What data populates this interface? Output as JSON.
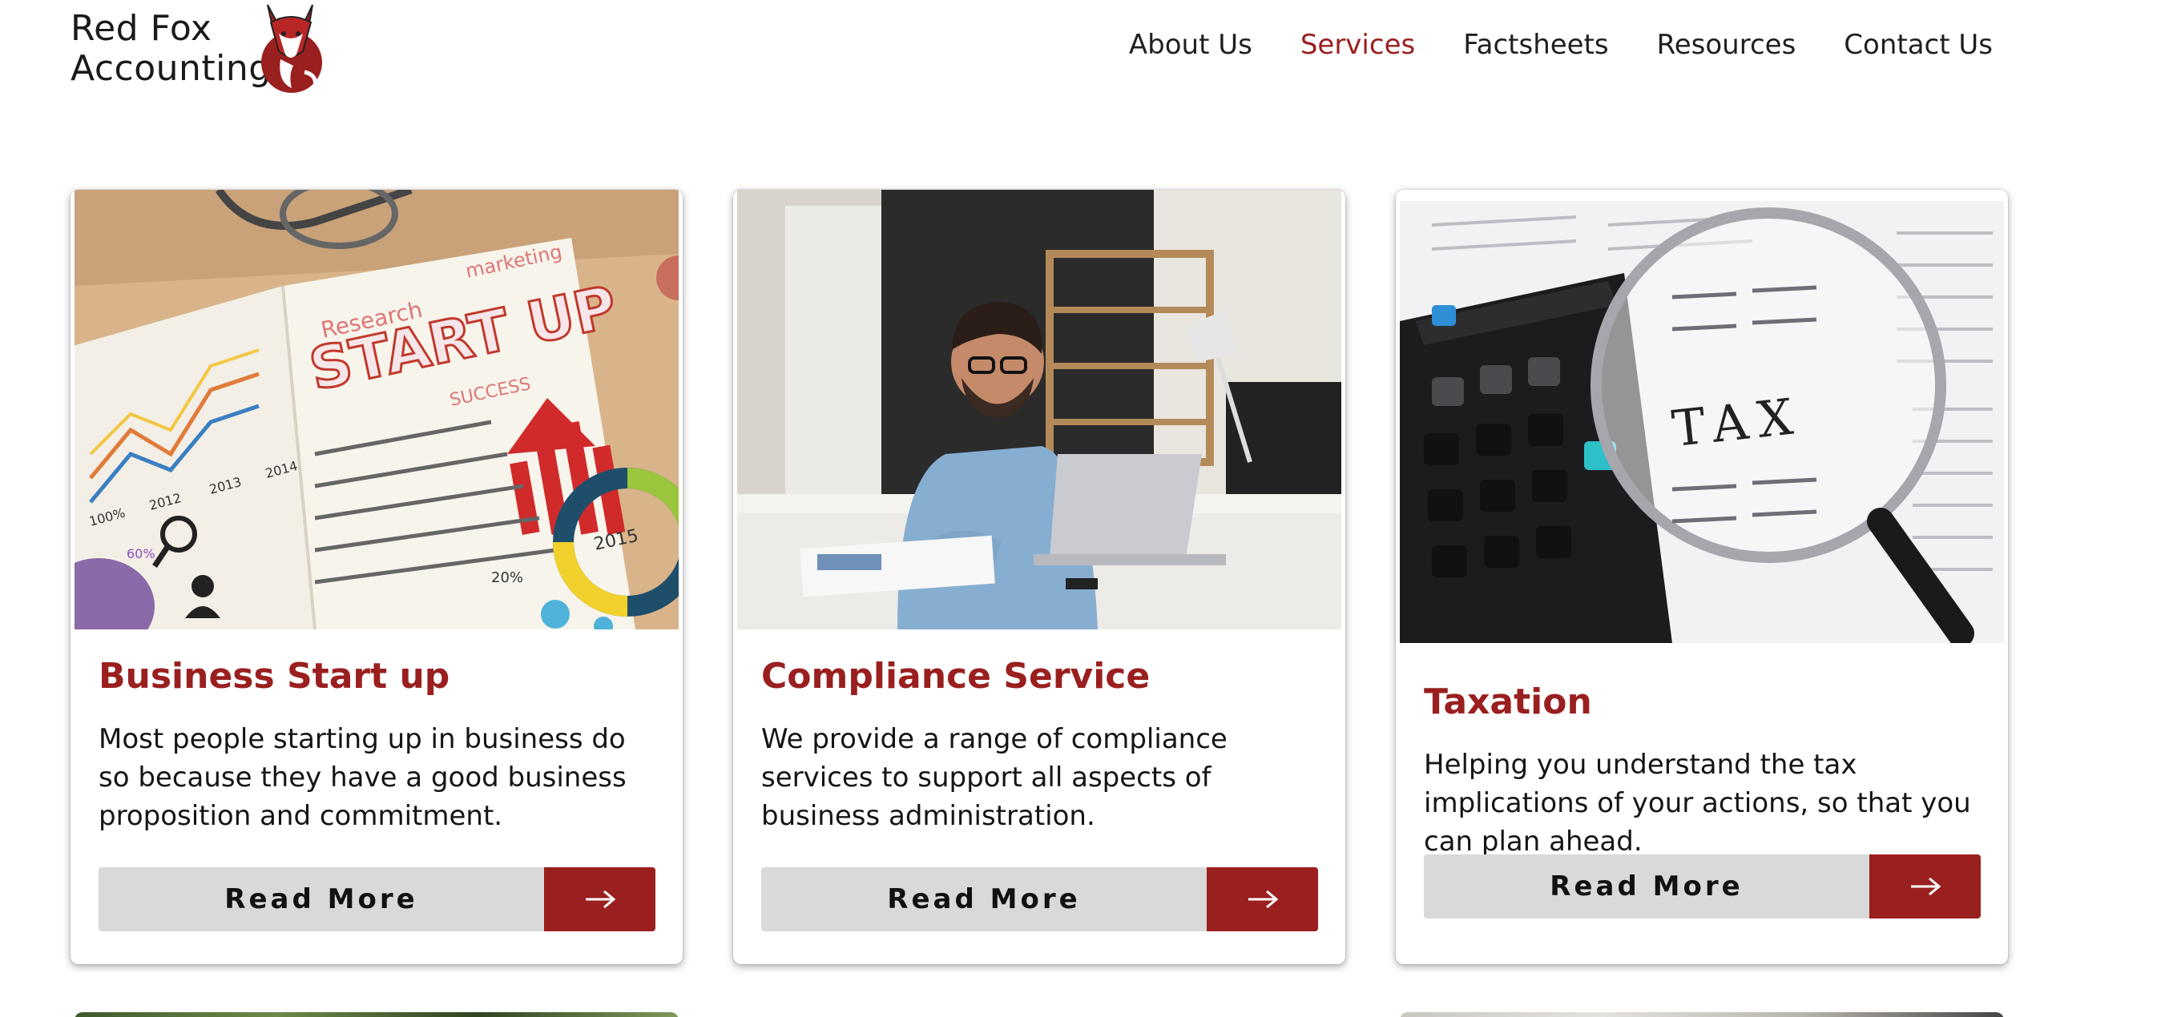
{
  "brand": {
    "line1": "Red Fox",
    "line2": "Accounting",
    "accent_color": "#9a1f1f",
    "logo_icon": "fox-icon"
  },
  "nav": {
    "items": [
      {
        "label": "About Us",
        "active": false
      },
      {
        "label": "Services",
        "active": true
      },
      {
        "label": "Factsheets",
        "active": false
      },
      {
        "label": "Resources",
        "active": false
      },
      {
        "label": "Contact Us",
        "active": false
      }
    ]
  },
  "cards": [
    {
      "title": "Business Start up",
      "description": "Most people starting up in business do so because they have a good business proposition and commitment.",
      "button_label": "Read More",
      "image": "startup-illustration",
      "image_text": [
        "START UP",
        "Research",
        "marketing",
        "SUCCESS",
        "100%",
        "2012",
        "2013",
        "2014",
        "2015",
        "60%",
        "20%"
      ],
      "arrow_icon": "arrow-right-icon"
    },
    {
      "title": "Compliance Service",
      "description": "We provide a range of compliance services to support all aspects of business administration.",
      "button_label": "Read More",
      "image": "man-at-desk-photo",
      "arrow_icon": "arrow-right-icon"
    },
    {
      "title": "Taxation",
      "description": "Helping you understand the tax implications of your actions, so that you can plan ahead.",
      "button_label": "Read More",
      "image": "tax-magnifier-photo",
      "image_text": [
        "TAX"
      ],
      "arrow_icon": "arrow-right-icon"
    }
  ]
}
